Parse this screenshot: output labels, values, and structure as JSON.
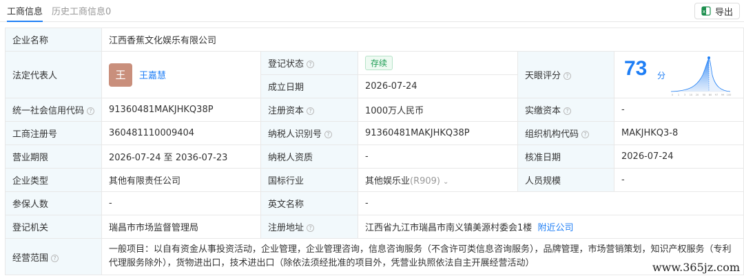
{
  "tabs": {
    "active": "工商信息",
    "inactive": "历史工商信息0"
  },
  "export_label": "导出",
  "rows": {
    "company_name": {
      "label": "企业名称",
      "value": "江西香蕉文化娱乐有限公司"
    },
    "legal_rep": {
      "label": "法定代表人",
      "avatar_char": "王",
      "name": "王嘉慧"
    },
    "reg_status": {
      "label": "登记状态",
      "value": "存续"
    },
    "found_date": {
      "label": "成立日期",
      "value": "2026-07-24"
    },
    "score": {
      "label": "天眼评分",
      "value": "73",
      "unit": "分",
      "axis": [
        "0",
        "1",
        "3",
        "10",
        "20",
        "50",
        "80",
        "97",
        "99",
        "100"
      ],
      "percentile_marker": 73
    },
    "credit_code": {
      "label": "统一社会信用代码",
      "value": "91360481MAKJHKQ38P"
    },
    "reg_capital": {
      "label": "注册资本",
      "value": "1000万人民币"
    },
    "paid_capital": {
      "label": "实缴资本",
      "value": "-"
    },
    "biz_reg_no": {
      "label": "工商注册号",
      "value": "360481110009404"
    },
    "taxpayer_id": {
      "label": "纳税人识别号",
      "value": "91360481MAKJHKQ38P"
    },
    "org_code": {
      "label": "组织机构代码",
      "value": "MAKJHKQ3-8"
    },
    "term": {
      "label": "营业期限",
      "value": "2026-07-24 至 2036-07-23"
    },
    "taxpayer_qual": {
      "label": "纳税人资质",
      "value": "-"
    },
    "approval_date": {
      "label": "核准日期",
      "value": "2026-07-24"
    },
    "company_type": {
      "label": "企业类型",
      "value": "其他有限责任公司"
    },
    "industry": {
      "label": "国标行业",
      "value": "其他娱乐业",
      "code": "(R909)"
    },
    "staff_size": {
      "label": "人员规模",
      "value": "-"
    },
    "insured": {
      "label": "参保人数",
      "value": "-"
    },
    "english_name": {
      "label": "英文名称",
      "value": "-"
    },
    "authority": {
      "label": "登记机关",
      "value": "瑞昌市市场监督管理局"
    },
    "address": {
      "label": "注册地址",
      "value": "江西省九江市瑞昌市南义镇美源村委会1楼",
      "link": "附近公司"
    },
    "scope": {
      "label": "经营范围",
      "value": "一般项目：以自有资金从事投资活动，企业管理，企业管理咨询，信息咨询服务（不含许可类信息咨询服务），品牌管理，市场营销策划，知识产权服务（专利代理服务除外），货物进出口，技术进出口（除依法须经批准的项目外，凭营业执照依法自主开展经营活动）"
    }
  },
  "watermark": "www.365jz.com",
  "colors": {
    "accent": "#1e7ef5",
    "label_bg": "#f2f9fc",
    "status_green": "#1f9d55",
    "avatar": "#c98f7c"
  }
}
